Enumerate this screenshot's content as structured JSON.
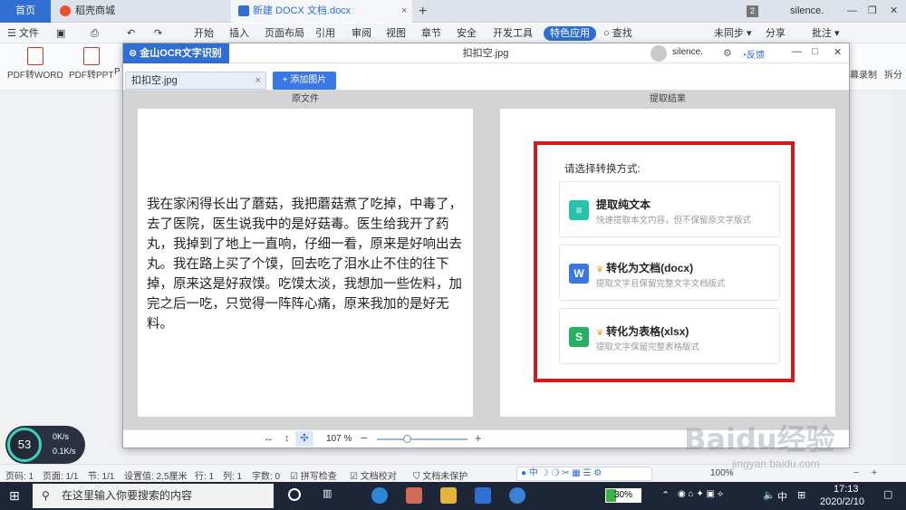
{
  "tabs": {
    "home": "首页",
    "daoke": "稻壳商城",
    "docx": "新建 DOCX 文档.docx",
    "count": "2",
    "user": "silence."
  },
  "menu": {
    "file": "文件",
    "items": [
      "开始",
      "插入",
      "页面布局",
      "引用",
      "审阅",
      "视图",
      "章节",
      "安全",
      "开发工具"
    ],
    "special": "特色应用",
    "search": "查找",
    "sync": "未同步",
    "share": "分享",
    "annotate": "批注"
  },
  "ribbon": {
    "pdf_word": "PDF转WORD",
    "pdf_ppt": "PDF转PPT",
    "pdf_p": "P",
    "screen_record": "幕录制",
    "split": "拆分"
  },
  "ocr": {
    "app_title": "金山OCR文字识别",
    "file_name": "扣扣空.jpg",
    "user": "silence.",
    "feedback": "反馈",
    "file_tab": "扣扣空.jpg",
    "add_image": "+ 添加图片",
    "left_header": "原文件",
    "right_header": "提取结果",
    "original_text": "我在家闲得长出了蘑菇，我把蘑菇煮了吃掉，中毒了，去了医院，医生说我中的是好菇毒。医生给我开了药丸，我掉到了地上一直响，仔细一看，原来是好响出去丸。我在路上买了个馍，回去吃了泪水止不住的往下掉，原来这是好寂馍。吃馍太淡，我想加一些佐料，加完之后一吃，只觉得一阵阵心痛，原来我加的是好无料。",
    "choose_label": "请选择转换方式:",
    "options": [
      {
        "title": "提取纯文本",
        "desc": "快速提取本文内容，但不保留原文字版式",
        "icon": "≡",
        "color": "#25c2ae"
      },
      {
        "title": "转化为文档(docx)",
        "desc": "提取文字且保留完整文字文档版式",
        "icon": "W",
        "color": "#3a78e0"
      },
      {
        "title": "转化为表格(xlsx)",
        "desc": "提取文字保留完整表格版式",
        "icon": "S",
        "color": "#27b063"
      }
    ],
    "zoom": "107 %"
  },
  "status": {
    "page": "页码: 1",
    "pages": "页面: 1/1",
    "section": "节: 1/1",
    "setting": "设置值: 2.5厘米",
    "row": "行: 1",
    "col": "列: 1",
    "words": "字数: 0",
    "spell": "拼写检查",
    "proof": "文档校对",
    "unprotected": "文档未保护",
    "zoom": "100%"
  },
  "speed": {
    "percent": "53",
    "up": "0K/s",
    "down": "0.1K/s"
  },
  "taskbar": {
    "search_placeholder": "在这里输入你要搜索的内容",
    "battery": "30%",
    "ime": "中",
    "time": "17:13",
    "date": "2020/2/10"
  },
  "watermark": {
    "logo": "Baidu经验",
    "url": "jingyan.baidu.com"
  }
}
